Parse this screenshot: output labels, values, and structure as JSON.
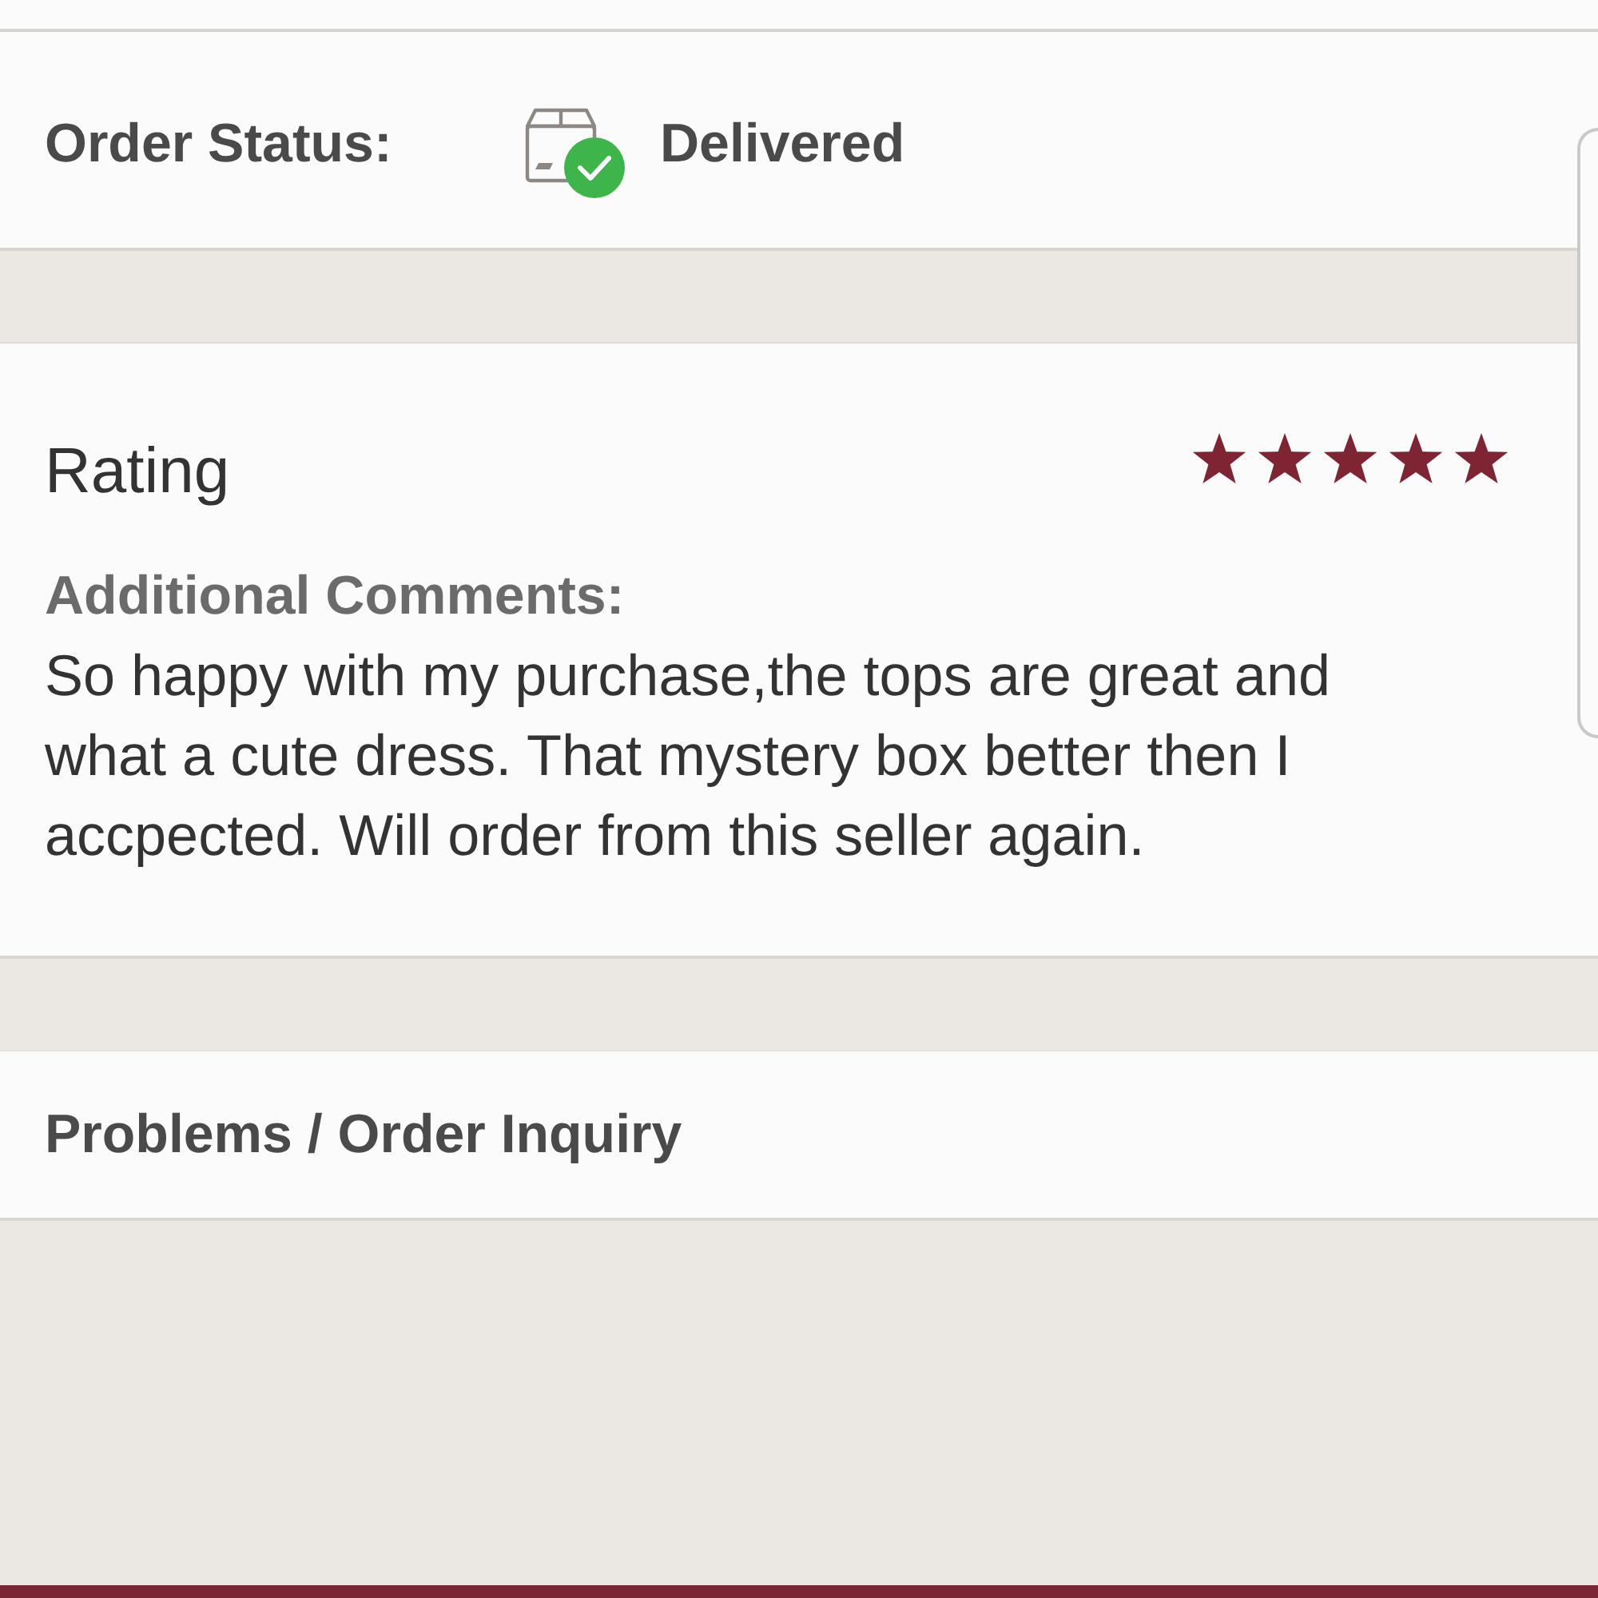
{
  "order_status": {
    "label": "Order Status:",
    "value": "Delivered"
  },
  "review": {
    "title": "Rating",
    "stars": 5,
    "comments_label": "Additional Comments:",
    "comments": "So happy with my purchase,the tops are great and what a cute dress. That mystery box better then I accpected. Will order from this seller again."
  },
  "inquiry": {
    "label": "Problems / Order Inquiry"
  }
}
